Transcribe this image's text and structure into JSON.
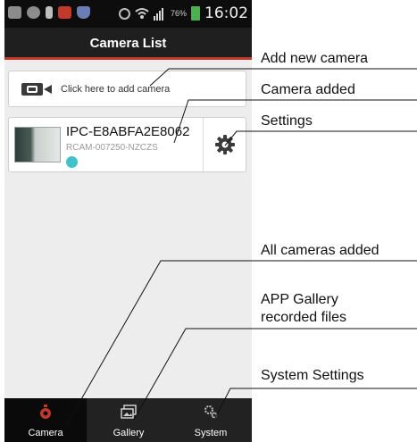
{
  "status_bar": {
    "battery_percent": "76%",
    "time": "16:02",
    "icons": [
      "back-icon",
      "location-icon",
      "usb-icon",
      "app-icon",
      "shield-icon",
      "alarm-icon",
      "wifi-icon",
      "signal-icon",
      "battery-icon"
    ]
  },
  "header": {
    "title": "Camera List"
  },
  "add_camera": {
    "label": "Click here to add camera",
    "icon": "camera-icon"
  },
  "camera": {
    "name": "IPC-E8ABFA2E8062",
    "id": "RCAM-007250-NZCZS",
    "status_color": "#3fc1c9",
    "settings_icon": "gear-icon"
  },
  "tabs": [
    {
      "label": "Camera",
      "icon": "camera-icon",
      "active": true,
      "color": "#c0392b"
    },
    {
      "label": "Gallery",
      "icon": "gallery-icon",
      "active": false
    },
    {
      "label": "System",
      "icon": "gear-icon",
      "active": false
    }
  ],
  "annotations": {
    "add_new_camera": "Add new camera",
    "camera_added": "Camera added",
    "settings": "Settings",
    "all_cameras_added": "All cameras added",
    "app_gallery_line1": "APP Gallery",
    "app_gallery_line2": "recorded files",
    "system_settings": "System Settings"
  },
  "colors": {
    "accent": "#c0392b",
    "header": "#1f1f1f",
    "background": "#ededed",
    "tabbar": "#222222"
  }
}
